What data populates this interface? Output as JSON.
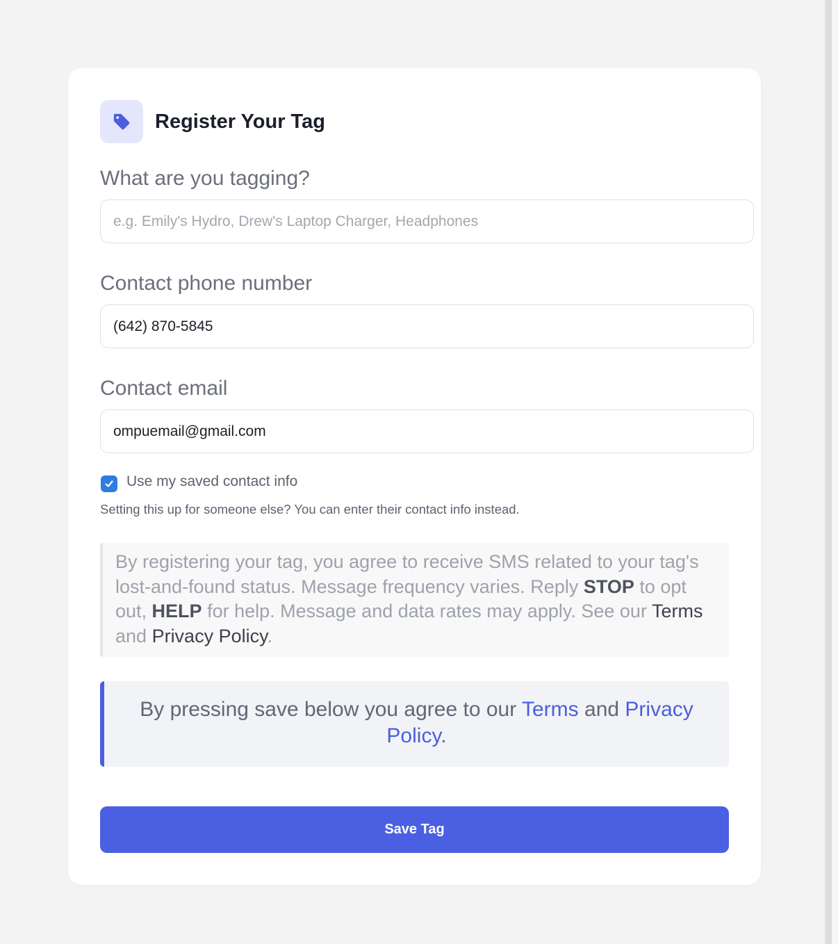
{
  "header": {
    "title": "Register Your Tag",
    "icon": "tag-icon",
    "accent_color": "#4b5fe2"
  },
  "fields": {
    "item": {
      "label": "What are you tagging?",
      "value": "",
      "placeholder": "e.g. Emily's Hydro, Drew's Laptop Charger, Headphones"
    },
    "phone": {
      "label": "Contact phone number",
      "value": "(642) 870-5845",
      "placeholder": ""
    },
    "email": {
      "label": "Contact email",
      "value": "ompuemail@gmail.com",
      "placeholder": ""
    }
  },
  "saved_contact": {
    "label": "Use my saved contact info",
    "checked": true,
    "icon": "check-icon"
  },
  "helper_text": "Setting this up for someone else? You can enter their contact info instead.",
  "sms_notice": {
    "part1": "By registering your tag, you agree to receive SMS related to your tag's lost-and-found status. Message frequency varies. Reply ",
    "stop": "STOP",
    "part2": " to opt out, ",
    "help": "HELP",
    "part3": " for help. Message and data rates may apply. See our ",
    "terms": "Terms",
    "and": " and ",
    "privacy": "Privacy Policy",
    "end": "."
  },
  "agreement": {
    "prefix": "By pressing save below you agree to our ",
    "terms": "Terms",
    "and": " and ",
    "privacy": "Privacy Policy",
    "end": "."
  },
  "save_button": {
    "label": "Save Tag"
  }
}
